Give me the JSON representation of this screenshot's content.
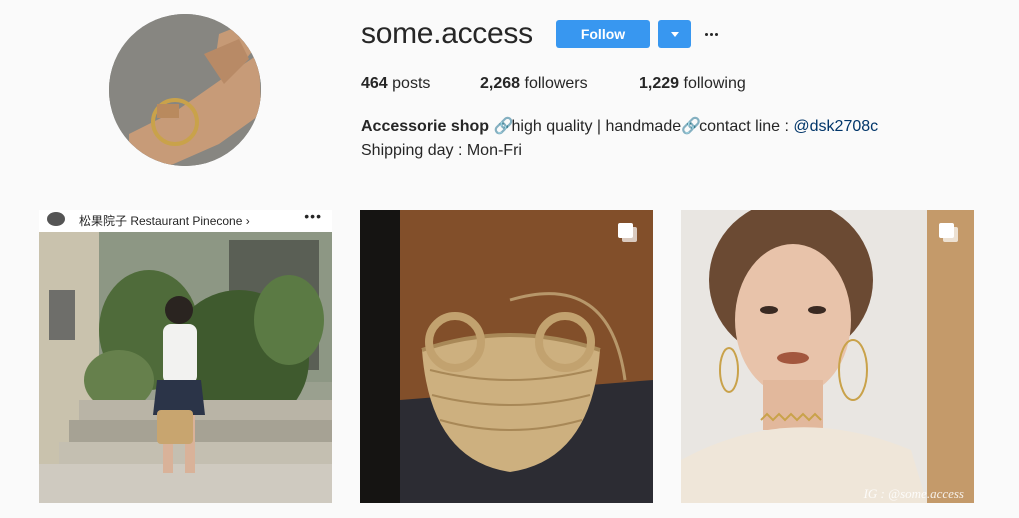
{
  "profile": {
    "username": "some.access",
    "follow_label": "Follow",
    "stats": {
      "posts_count": "464",
      "posts_label": "posts",
      "followers_count": "2,268",
      "followers_label": "followers",
      "following_count": "1,229",
      "following_label": "following"
    },
    "bio": {
      "name": "Accessorie shop",
      "link_glyph": "🔗",
      "text1": "high quality | handmade",
      "text2": "contact line : ",
      "mention": "@dsk2708c",
      "line2": "Shipping day : Mon-Fri"
    },
    "accent_color": "#3897f0"
  },
  "posts": [
    {
      "description_hidden": false,
      "topbar_text": "松果院子 Restaurant Pinecone ›",
      "topbar_dots": "•••",
      "multiple": false
    },
    {
      "multiple": true
    },
    {
      "multiple": true,
      "watermark": "IG : @some.access"
    }
  ]
}
